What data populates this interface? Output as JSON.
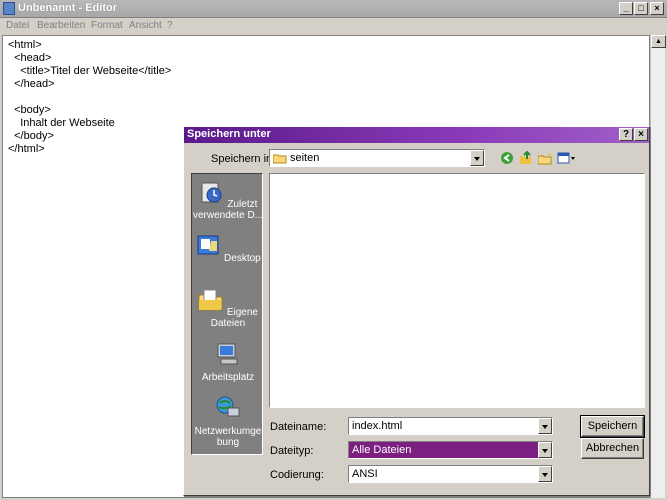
{
  "editor": {
    "title": "Unbenannt - Editor",
    "menu": [
      "Datei",
      "Bearbeiten",
      "Format",
      "Ansicht",
      "?"
    ],
    "lines": [
      "<html>",
      "  <head>",
      "    <title>Titel der Webseite</title>",
      "  </head>",
      "",
      "  <body>",
      "    Inhalt der Webseite",
      "  </body>",
      "</html>"
    ]
  },
  "dialog": {
    "title": "Speichern unter",
    "save_in_label": "Speichern in:",
    "save_in_value": "seiten",
    "places": [
      {
        "label": "Zuletzt verwendete D...",
        "icon": "recent-icon"
      },
      {
        "label": "Desktop",
        "icon": "desktop-icon"
      },
      {
        "label": "Eigene Dateien",
        "icon": "my-documents-icon"
      },
      {
        "label": "Arbeitsplatz",
        "icon": "my-computer-icon"
      },
      {
        "label": "Netzwerkumge bung",
        "icon": "network-icon"
      }
    ],
    "filename_label": "Dateiname:",
    "filename_value": "index.html",
    "filetype_label": "Dateityp:",
    "filetype_value": "Alle Dateien",
    "encoding_label": "Codierung:",
    "encoding_value": "ANSI",
    "save_button": "Speichern",
    "cancel_button": "Abbrechen"
  },
  "colors": {
    "dialog_title_gradient_start": "#5a1a8a",
    "selection": "#7b1f80"
  }
}
